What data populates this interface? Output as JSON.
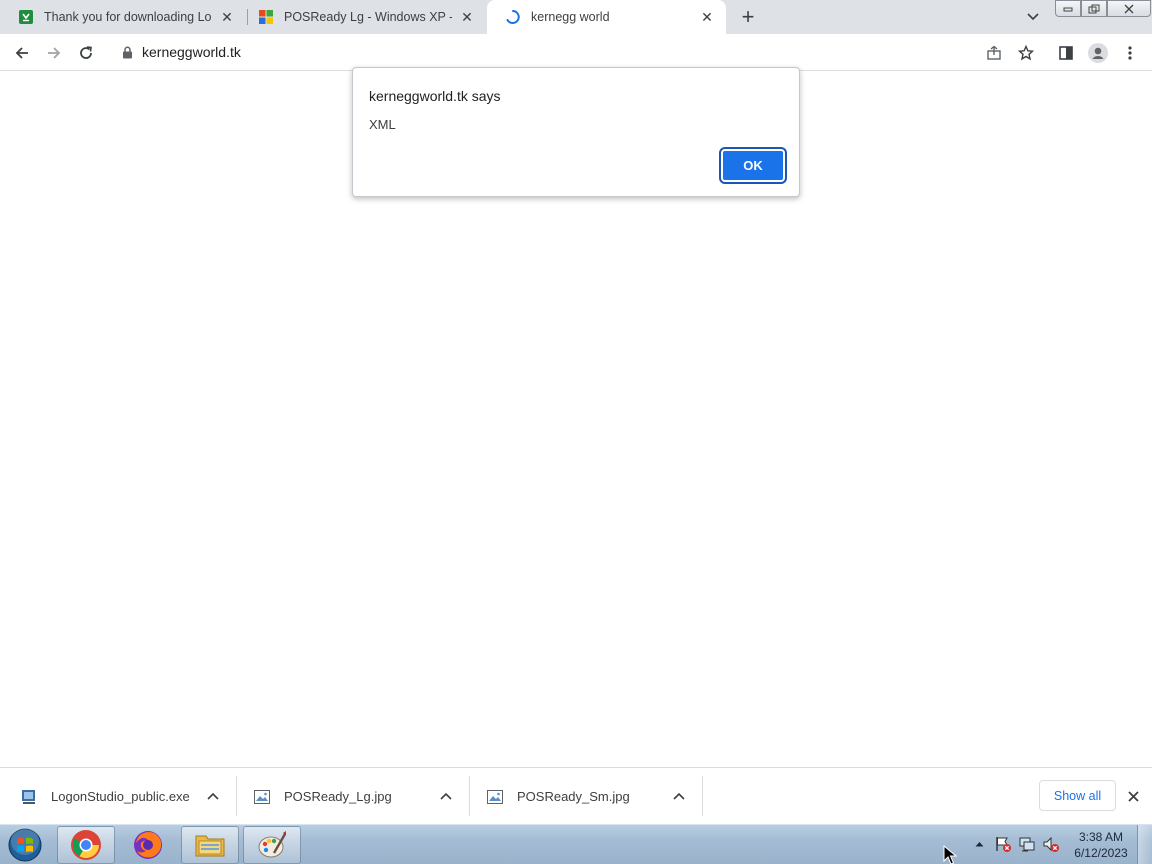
{
  "browser": {
    "tabs": [
      {
        "title": "Thank you for downloading Logo",
        "icon": "green-download-favicon",
        "active": false
      },
      {
        "title": "POSReady Lg - Windows XP - Wi",
        "icon": "windows-xp-favicon",
        "active": false
      },
      {
        "title": "kernegg world",
        "icon": "loading-spinner",
        "active": true
      }
    ],
    "new_tab_label": "+",
    "address": "kerneggworld.tk"
  },
  "alert": {
    "heading": "kerneggworld.tk says",
    "message": "XML",
    "ok_label": "OK"
  },
  "downloads": {
    "items": [
      {
        "name": "LogonStudio_public.exe",
        "icon": "installer-icon"
      },
      {
        "name": "POSReady_Lg.jpg",
        "icon": "image-file-icon"
      },
      {
        "name": "POSReady_Sm.jpg",
        "icon": "image-file-icon"
      }
    ],
    "show_all_label": "Show all"
  },
  "taskbar": {
    "apps": [
      "chrome-icon",
      "firefox-icon",
      "file-explorer-icon",
      "paint-icon"
    ],
    "clock_time": "3:38 AM",
    "clock_date": "6/12/2023"
  },
  "colors": {
    "accent": "#1a73e8",
    "tabstrip": "#dee1e6",
    "taskbar": "#a4bcd4"
  }
}
